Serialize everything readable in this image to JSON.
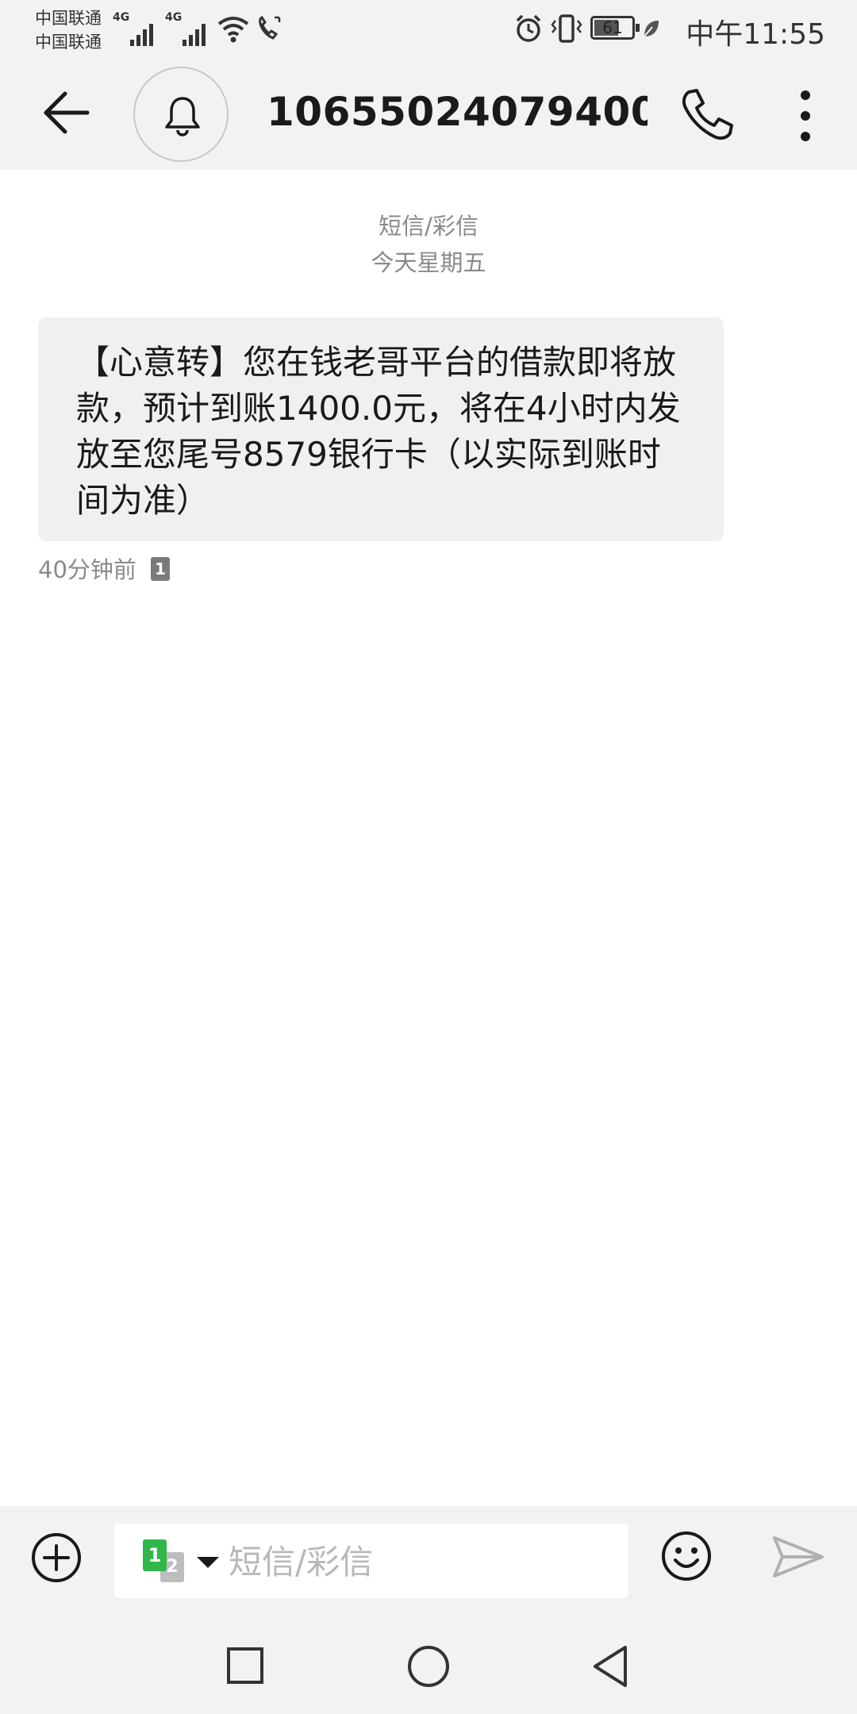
{
  "status_bar": {
    "carrier_1": "中国联通",
    "carrier_2": "中国联通",
    "network_1": "4G",
    "network_2": "4G",
    "battery": "61",
    "time": "中午11:55"
  },
  "header": {
    "contact": "10655024079400..."
  },
  "conversation": {
    "type_label": "短信/彩信",
    "date_label": "今天星期五",
    "messages": [
      {
        "text": "【心意转】您在钱老哥平台的借款即将放款，预计到账1400.0元，将在4小时内发放至您尾号8579银行卡（以实际到账时间为准）",
        "time": "40分钟前",
        "sim": "1"
      }
    ]
  },
  "composer": {
    "placeholder": "短信/彩信",
    "sim_primary": "1",
    "sim_secondary": "2"
  },
  "colors": {
    "background": "#ffffff",
    "chrome": "#f2f2f2",
    "bubble": "#f0f0f0",
    "muted_text": "#8a8a8a",
    "sim_green": "#2fb84a"
  },
  "icons": {
    "back": "arrow-left-icon",
    "notify": "bell-icon",
    "call": "phone-icon",
    "more": "more-vertical-icon",
    "add": "plus-circle-icon",
    "emoji": "smiley-icon",
    "send": "send-icon"
  }
}
